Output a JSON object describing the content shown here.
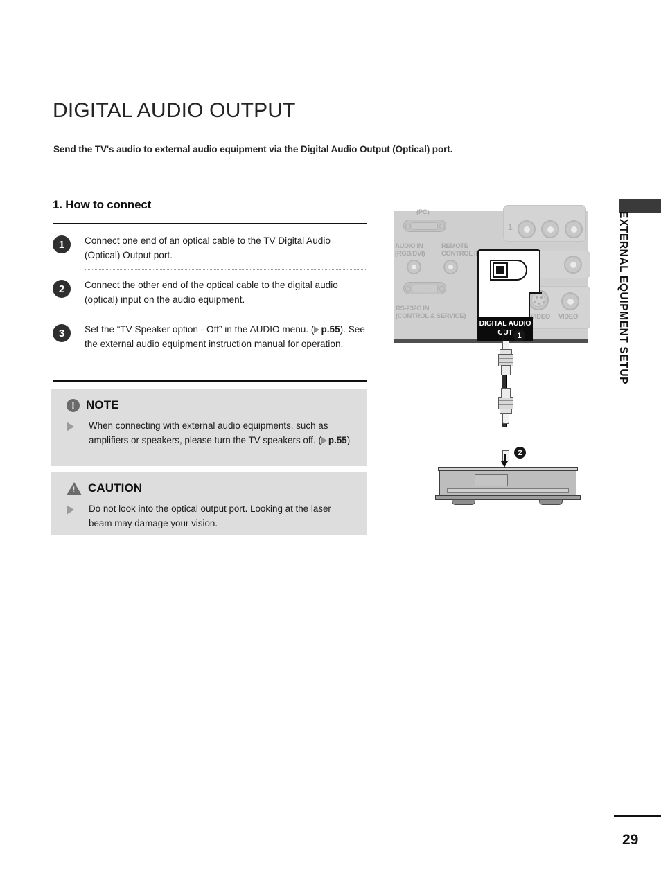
{
  "page": {
    "title": "DIGITAL AUDIO OUTPUT",
    "subtitle": "Send the TV's audio to external audio equipment via the Digital Audio Output (Optical) port.",
    "number": "29",
    "side_tab_label": "EXTERNAL EQUIPMENT SETUP"
  },
  "section": {
    "heading": "1. How to connect"
  },
  "steps": [
    {
      "number": "1",
      "text": "Connect one end of an optical cable to the TV Digital Audio (Optical) Output port."
    },
    {
      "number": "2",
      "text": "Connect the other end of the optical cable to the digital audio (optical) input on the audio equipment."
    },
    {
      "number": "3",
      "text_before": "Set the “TV Speaker option - Off” in the AUDIO menu. (",
      "page_ref": "p.55",
      "text_after": "). See the external audio equipment instruction manual for operation."
    }
  ],
  "note": {
    "badge": "!",
    "title": "NOTE",
    "text_before": "When connecting with external audio equipments, such as amplifiers or speakers, please turn the TV speakers off.  (",
    "page_ref": "p.55",
    "text_after": ")"
  },
  "caution": {
    "badge": "!",
    "title": "CAUTION",
    "text": "Do not look into the optical output port. Looking at the laser beam may damage your vision."
  },
  "diagram": {
    "tv_panel": {
      "pc_label": "(PC)",
      "audio_in_label": "AUDIO IN\n(RGB/DVI)",
      "remote_label": "REMOTE\nCONTROL IN",
      "rs232_label": "RS-232C IN\n(CONTROL & SERVICE)",
      "component_number": "1",
      "svideo_label": "S-VIDEO",
      "video_label": "VIDEO"
    },
    "optical_callout": {
      "optical_label": "OPTICAL",
      "digital_audio_out_label": "DIGITAL AUDIO\nOUT"
    },
    "callout_numbers": {
      "tv_end": "1",
      "equipment_end": "2"
    }
  },
  "colors": {
    "accent_dark": "#2f2f2f",
    "box_bg": "#dddddd",
    "panel_bg": "#cfcfcf",
    "side_tab": "#3a3a3a"
  }
}
